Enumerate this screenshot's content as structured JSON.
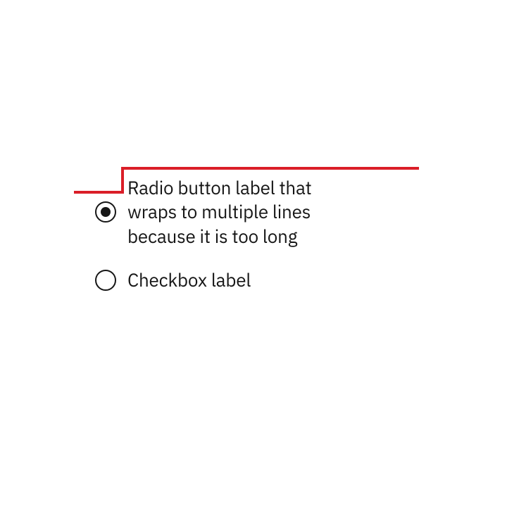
{
  "colors": {
    "accent_red": "#da1e28",
    "text": "#161616"
  },
  "radios": [
    {
      "label": "Radio button label that wraps to multiple lines because it is too long",
      "checked": true
    },
    {
      "label": "Checkbox label",
      "checked": false
    }
  ]
}
